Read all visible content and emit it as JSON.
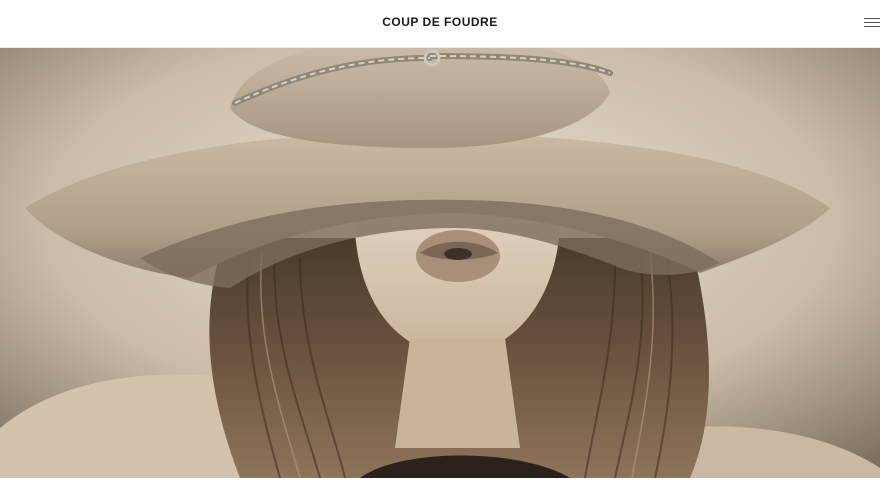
{
  "header": {
    "brand": "COUP DE FOUDRE",
    "menu_icon": "hamburger-menu-icon"
  },
  "hero": {
    "image": "sepia-portrait-woman-wide-brim-hat",
    "palette": {
      "background_light": "#e6dccd",
      "background_dark": "#8a7d6c",
      "hat": "#bfae9b",
      "hat_shadow": "#8f806f",
      "skin": "#d8c6b2",
      "hair": "#5e4a38",
      "hair_dark": "#3a2c20",
      "chain": "#9a9386"
    }
  }
}
